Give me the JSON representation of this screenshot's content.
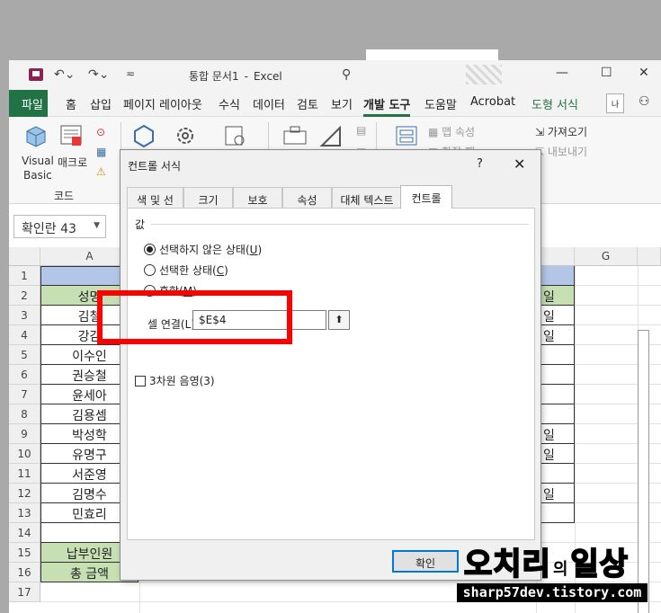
{
  "window": {
    "title": "통합 문서1",
    "app": "Excel"
  },
  "menu": {
    "file": "파일",
    "tabs": [
      "홈",
      "삽입",
      "페이지 레이아웃",
      "수식",
      "데이터",
      "검토",
      "보기",
      "개발 도구",
      "도움말",
      "Acrobat",
      "도형 서식"
    ],
    "more": "나"
  },
  "ribbon": {
    "visual_basic": "Visual\nBasic",
    "visual_basic_l1": "Visual",
    "visual_basic_l2": "Basic",
    "macro": "매크로",
    "group_code": "코드",
    "control_props": "맵 속성",
    "control_props2": "확장 팩",
    "import": "가져오기",
    "export": "내보내기"
  },
  "namebox": {
    "value": "확인란 43"
  },
  "columns": [
    "A",
    "G"
  ],
  "rows": [
    "1",
    "2",
    "3",
    "4",
    "5",
    "6",
    "7",
    "8",
    "9",
    "10",
    "11",
    "12",
    "13",
    "14",
    "15",
    "16",
    "17"
  ],
  "colA": [
    "",
    "성명",
    "김철수",
    "강감찬",
    "이수인",
    "권승철",
    "윤세아",
    "김용셈",
    "박성학",
    "유명구",
    "서준영",
    "김명수",
    "민효리",
    "",
    "납부인원",
    "총 금액",
    ""
  ],
  "colA_visible": [
    "",
    "성명",
    "김철",
    "강감",
    "이수인",
    "권승철",
    "윤세아",
    "김용셈",
    "박성학",
    "유명구",
    "서준영",
    "김명수",
    "민효리",
    "",
    "납부인원",
    "총 금액",
    ""
  ],
  "colR": [
    "",
    "일",
    "일",
    "일",
    "",
    "",
    "",
    "",
    "일",
    "일",
    "",
    "일",
    "",
    "",
    "",
    "",
    ""
  ],
  "dialog": {
    "title": "컨트롤 서식",
    "help": "?",
    "close": "✕",
    "tabs": [
      "색 및 선",
      "크기",
      "보호",
      "속성",
      "대체 텍스트",
      "컨트롤"
    ],
    "group_label": "값",
    "options": [
      "선택하지 않은 상태(U)",
      "선택한 상태(C)",
      "혼합(M)"
    ],
    "option_keys": [
      "U",
      "C",
      "M"
    ],
    "option_texts": [
      "선택하지 않은 상태",
      "선택한 상태",
      "혼합"
    ],
    "link_label": "셀 연결(L):",
    "link_value": "$E$4",
    "shading_label": "3차원 음영(3)",
    "ok": "확인"
  },
  "watermark": {
    "title": "오치리의 일상",
    "title_main": "오치리",
    "title_mid": "의",
    "title_end": "일상",
    "url": "sharp57dev.tistory.com"
  },
  "colors": {
    "excel_green": "#217346",
    "header_green": "#c6e0b4",
    "header_blue": "#b4c6e7",
    "highlight_red": "#ff0000"
  }
}
